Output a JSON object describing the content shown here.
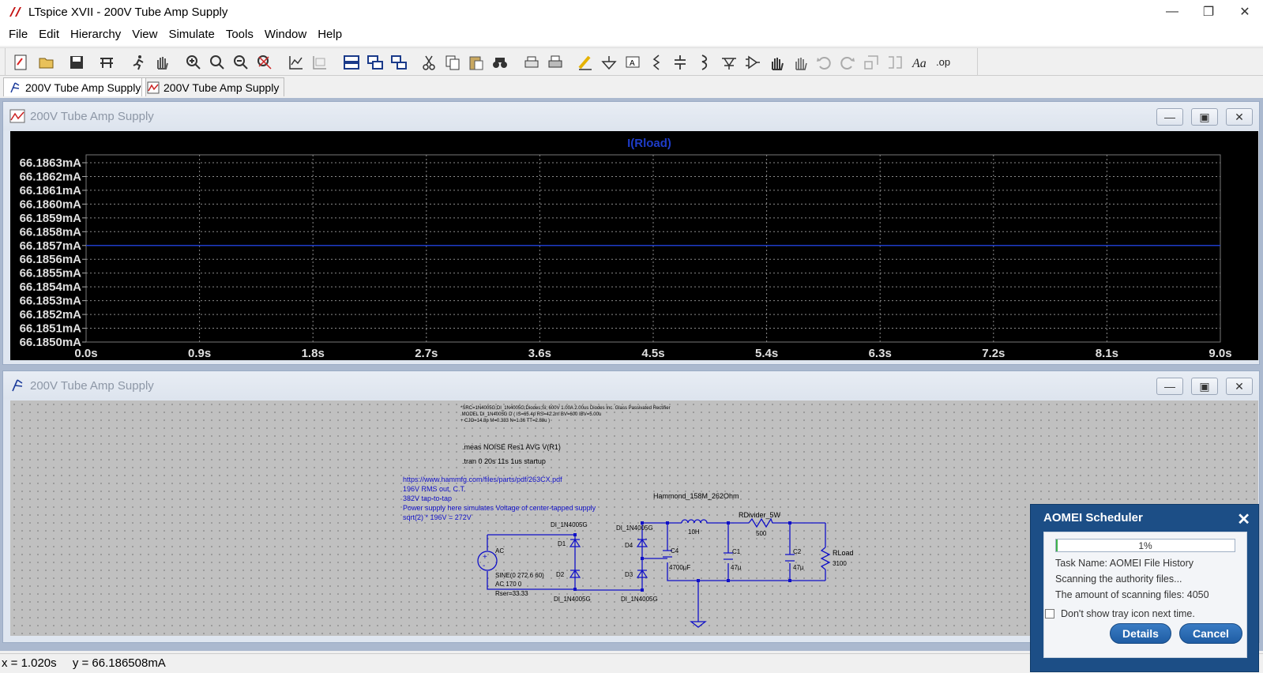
{
  "app": {
    "title": "LTspice XVII - 200V Tube Amp Supply"
  },
  "menu": [
    "File",
    "Edit",
    "Hierarchy",
    "View",
    "Simulate",
    "Tools",
    "Window",
    "Help"
  ],
  "toolbar_icons": [
    "new-schematic",
    "open",
    "save",
    "control-panel",
    "run",
    "halt",
    "zoom-in",
    "zoom-box",
    "zoom-out",
    "zoom-fit",
    "autorange",
    "waveform",
    "tile-horizontal",
    "tile-vertical",
    "cascade",
    "cut",
    "copy",
    "paste",
    "find",
    "print-setup",
    "print",
    "draw-wire",
    "ground",
    "label-net",
    "resistor",
    "capacitor",
    "inductor",
    "diode",
    "component",
    "move",
    "drag",
    "undo",
    "redo",
    "rotate",
    "mirror",
    "text",
    "spice-directive"
  ],
  "tabs": [
    {
      "label": "200V Tube Amp Supply",
      "kind": "schematic"
    },
    {
      "label": "200V Tube Amp Supply",
      "kind": "waveform"
    }
  ],
  "plot_window": {
    "title": "200V Tube Amp Supply"
  },
  "schematic_window": {
    "title": "200V Tube Amp Supply"
  },
  "chart_data": {
    "type": "line",
    "title": "I(Rload)",
    "xlabel": "",
    "ylabel": "",
    "x_ticks": [
      "0.0s",
      "0.9s",
      "1.8s",
      "2.7s",
      "3.6s",
      "4.5s",
      "5.4s",
      "6.3s",
      "7.2s",
      "8.1s",
      "9.0s"
    ],
    "y_ticks": [
      "66.1863mA",
      "66.1862mA",
      "66.1861mA",
      "66.1860mA",
      "66.1859mA",
      "66.1858mA",
      "66.1857mA",
      "66.1856mA",
      "66.1855mA",
      "66.1854mA",
      "66.1853mA",
      "66.1852mA",
      "66.1851mA",
      "66.1850mA"
    ],
    "xlim": [
      0,
      9.0
    ],
    "ylim": [
      66.185,
      66.1863
    ],
    "grid": true,
    "series": [
      {
        "name": "I(Rload)",
        "color": "#1e3cc8",
        "x": [
          0,
          9.0
        ],
        "y": [
          66.1857,
          66.1857
        ]
      }
    ]
  },
  "schematic": {
    "model_lines": [
      "*SRC=1N4005G;DI_1N4005G;Diodes;Si;  600V  1.00A  2.00us   Diodes Inc. Glass Passivated Rectifier",
      ".MODEL DI_1N4005G D  ( IS=65.4p  RS=42.2m BV=600 IBV=5.00u",
      "+ CJO=14.8p  M=0.333 N=1.36 TT=2.88u )"
    ],
    "meas_directive": ".meas NOISE Res1 AVG V(R1)",
    "tran_directive": ".tran 0 20s 11s 1us startup",
    "comments": [
      "https://www.hammfg.com/files/parts/pdf/263CX.pdf",
      "196V RMS out, C.T.",
      "382V tap-to-tap",
      "Power supply here simulates Voltage of center-tapped supply",
      "sqrt(2) * 196V = 272V"
    ],
    "labels": {
      "hammond": "Hammond_158M_262Ohm",
      "l_value": "10H",
      "rdivider": "RDivider_5W",
      "rdivider_value": "500",
      "c4": "C4",
      "c4_value": "4700µF",
      "c1": "C1",
      "c1_value": "47µ",
      "c2": "C2",
      "c2_value": "47µ",
      "rload": "RLoad",
      "rload_value": "3100",
      "source": "AC",
      "source_sine": "SINE(0 272.6 60)",
      "source_ac": "AC 170 0",
      "source_rser": "Rser=33.33",
      "d1": "D1",
      "d2": "D2",
      "d3": "D3",
      "d4": "D4",
      "d_model": "DI_1N4005G"
    }
  },
  "status": {
    "x": "x = 1.020s",
    "y": "y = 66.186508mA"
  },
  "popup": {
    "title": "AOMEI Scheduler",
    "progress_label": "1%",
    "progress": 0.01,
    "task_name": "Task Name: AOMEI File History",
    "scanning": "Scanning the authority files...",
    "amount": "The amount of scanning files: 4050",
    "checkbox_label": "Don't show tray icon next time.",
    "details_label": "Details",
    "cancel_label": "Cancel"
  }
}
